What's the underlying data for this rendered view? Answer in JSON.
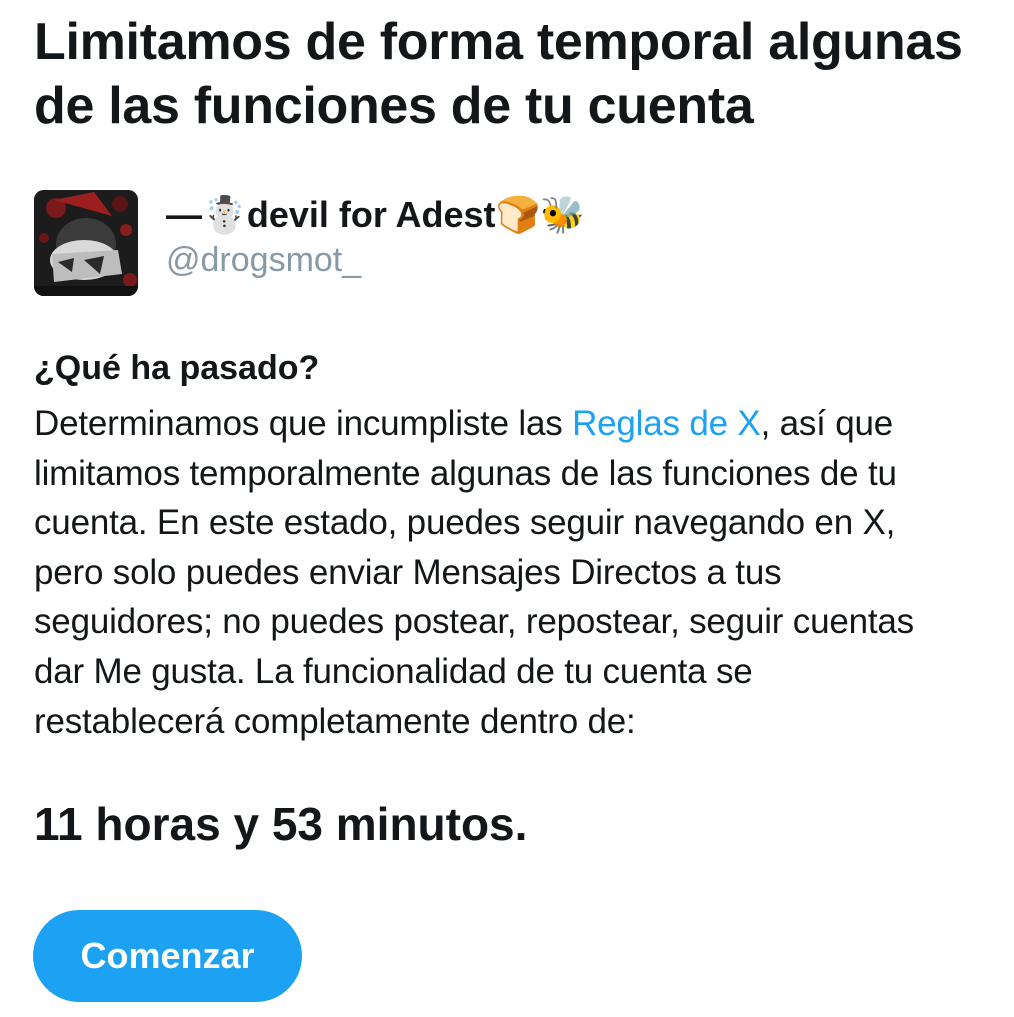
{
  "page": {
    "title_line1": "Limitamos de forma temporal algunas",
    "title_line2": "de las funciones de tu cuenta"
  },
  "account": {
    "display_name": "—☃️devil for Adest🍞🐝",
    "handle": "@drogsmot_",
    "avatar_icon": "avatar-image"
  },
  "explanation": {
    "heading": "¿Qué ha pasado?",
    "line1_before_link": "Determinamos que incumpliste las ",
    "link_text": "Reglas de X",
    "line1_after_link": ", así que",
    "line2": "limitamos temporalmente algunas de las funciones de tu",
    "line3": "cuenta. En este estado, puedes seguir navegando en X,",
    "line4": "pero solo puedes enviar Mensajes Directos a tus",
    "line5": "seguidores; no puedes postear, repostear, seguir cuentas",
    "line6": "dar Me gusta. La funcionalidad de tu cuenta se",
    "line7": "restablecerá completamente dentro de:"
  },
  "countdown": {
    "text": "11 horas y 53 minutos."
  },
  "actions": {
    "start_label": "Comenzar"
  },
  "colors": {
    "accent": "#1da1f2",
    "text": "#14171a",
    "secondary_text": "#8899a6",
    "background": "#ffffff"
  }
}
